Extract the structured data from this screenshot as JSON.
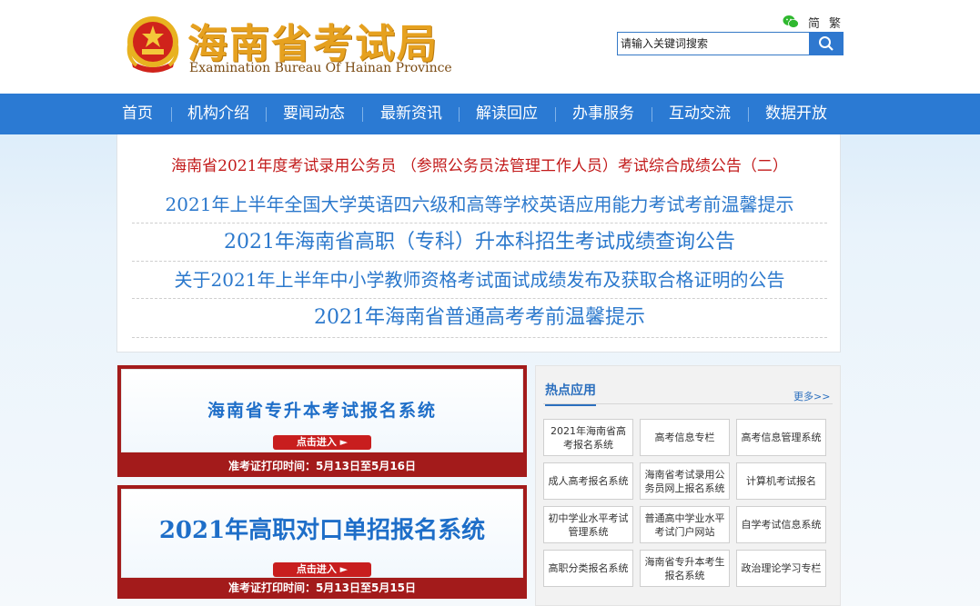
{
  "header": {
    "logo_cn": "海南省考试局",
    "logo_en": "Examination Bureau Of Hainan Province",
    "lang_simplified": "简",
    "lang_traditional": "繁",
    "search_placeholder": "请输入关键词搜索",
    "icons": {
      "wechat": "wechat-icon",
      "search": "search-icon",
      "emblem": "national-emblem"
    }
  },
  "nav": {
    "items": [
      "首页",
      "机构介绍",
      "要闻动态",
      "最新资讯",
      "解读回应",
      "办事服务",
      "互动交流",
      "数据开放"
    ]
  },
  "headlines": [
    "海南省2021年度考试录用公务员 （参照公务员法管理工作人员）考试综合成绩公告（二）",
    "2021年上半年全国大学英语四六级和高等学校英语应用能力考试考前温馨提示",
    "2021年海南省高职（专科）升本科招生考试成绩查询公告",
    "关于2021年上半年中小学教师资格考试面试成绩发布及获取合格证明的公告",
    "2021年海南省普通高考考前温馨提示"
  ],
  "banners": [
    {
      "title": "海南省专升本考试报名系统",
      "button": "点击进入 ►",
      "footer": "准考证打印时间：5月13日至5月16日"
    },
    {
      "title": "2021年高职对口单招报名系统",
      "button": "点击进入 ►",
      "footer": "准考证打印时间：5月13日至5月15日"
    }
  ],
  "hot_apps": {
    "title": "热点应用",
    "more": "更多>>",
    "tiles": [
      "2021年海南省高考报名系统",
      "高考信息专栏",
      "高考信息管理系统",
      "成人高考报名系统",
      "海南省考试录用公务员网上报名系统",
      "计算机考试报名",
      "初中学业水平考试管理系统",
      "普通高中学业水平考试门户网站",
      "自学考试信息系统",
      "高职分类报名系统",
      "海南省专升本考生报名系统",
      "政治理论学习专栏"
    ]
  },
  "colors": {
    "nav_bg": "#2b7ad3",
    "headline_red": "#c21a1a",
    "headline_blue": "#2b78cc",
    "banner_frame": "#a31b1b",
    "logo_gold": "#e6a11f"
  }
}
